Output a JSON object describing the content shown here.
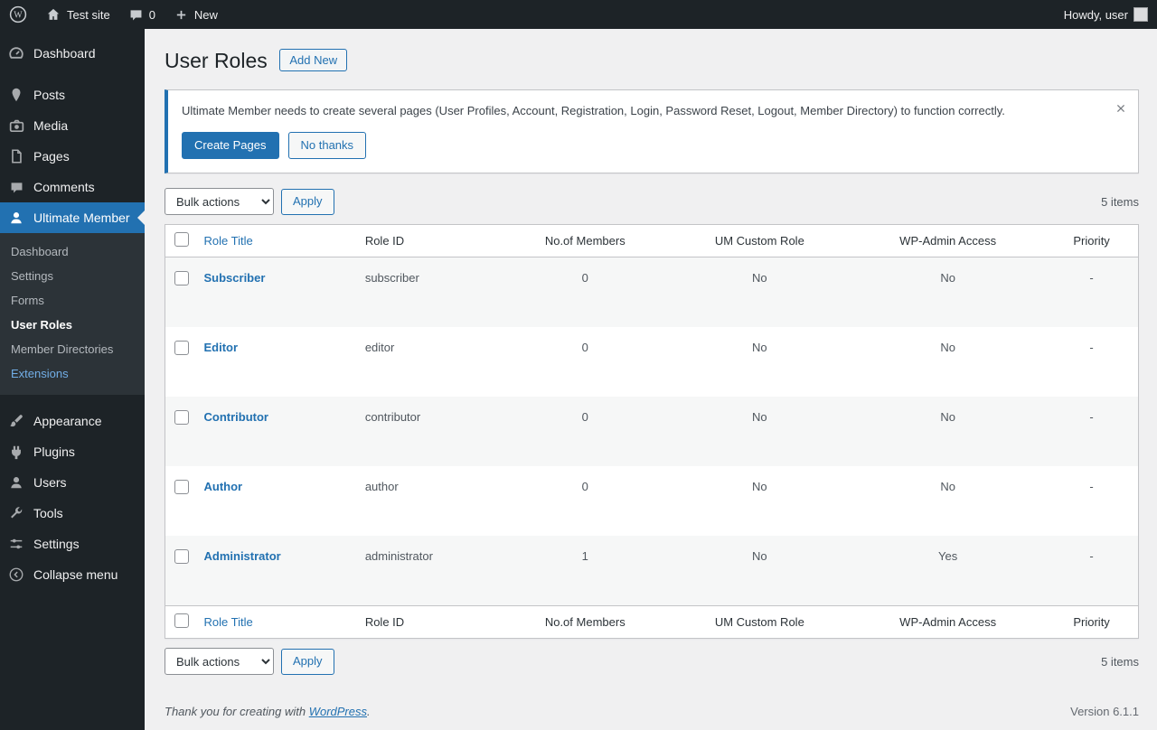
{
  "colors": {
    "accent": "#2271b1",
    "admin_bar_bg": "#1d2327",
    "sidebar_bg": "#1d2327",
    "submenu_bg": "#2c3338",
    "content_bg": "#f0f0f1",
    "striped_row": "#f6f7f7",
    "submenu_highlight": "#72aee6"
  },
  "icons": {
    "wordpress-logo": "W in circle",
    "home-icon": "house",
    "comments-icon": "speech bubble",
    "plus-icon": "plus",
    "close-icon": "x",
    "chevron-down-icon": "native select arrow"
  },
  "admin_bar": {
    "site_name": "Test site",
    "comments_count": "0",
    "new_label": "New",
    "howdy": "Howdy, user"
  },
  "sidebar": {
    "items": [
      {
        "label": "Dashboard"
      },
      {
        "label": "Posts"
      },
      {
        "label": "Media"
      },
      {
        "label": "Pages"
      },
      {
        "label": "Comments"
      },
      {
        "label": "Ultimate Member"
      },
      {
        "label": "Appearance"
      },
      {
        "label": "Plugins"
      },
      {
        "label": "Users"
      },
      {
        "label": "Tools"
      },
      {
        "label": "Settings"
      },
      {
        "label": "Collapse menu"
      }
    ],
    "um_submenu": [
      "Dashboard",
      "Settings",
      "Forms",
      "User Roles",
      "Member Directories",
      "Extensions"
    ]
  },
  "page": {
    "title": "User Roles",
    "add_new_label": "Add New"
  },
  "notice": {
    "text": "Ultimate Member needs to create several pages (User Profiles, Account, Registration, Login, Password Reset, Logout, Member Directory) to function correctly.",
    "create_pages_label": "Create Pages",
    "no_thanks_label": "No thanks"
  },
  "toolbar": {
    "bulk_actions_label": "Bulk actions",
    "apply_label": "Apply",
    "items_count": "5 items"
  },
  "table": {
    "headers": {
      "title": "Role Title",
      "id": "Role ID",
      "members": "No.of Members",
      "custom": "UM Custom Role",
      "admin": "WP-Admin Access",
      "priority": "Priority"
    },
    "rows": [
      {
        "title": "Subscriber",
        "id": "subscriber",
        "members": "0",
        "custom": "No",
        "admin": "No",
        "priority": "-"
      },
      {
        "title": "Editor",
        "id": "editor",
        "members": "0",
        "custom": "No",
        "admin": "No",
        "priority": "-"
      },
      {
        "title": "Contributor",
        "id": "contributor",
        "members": "0",
        "custom": "No",
        "admin": "No",
        "priority": "-"
      },
      {
        "title": "Author",
        "id": "author",
        "members": "0",
        "custom": "No",
        "admin": "No",
        "priority": "-"
      },
      {
        "title": "Administrator",
        "id": "administrator",
        "members": "1",
        "custom": "No",
        "admin": "Yes",
        "priority": "-"
      }
    ]
  },
  "footer": {
    "thanks_prefix": "Thank you for creating with ",
    "wordpress": "WordPress",
    "period": ".",
    "version": "Version 6.1.1"
  }
}
